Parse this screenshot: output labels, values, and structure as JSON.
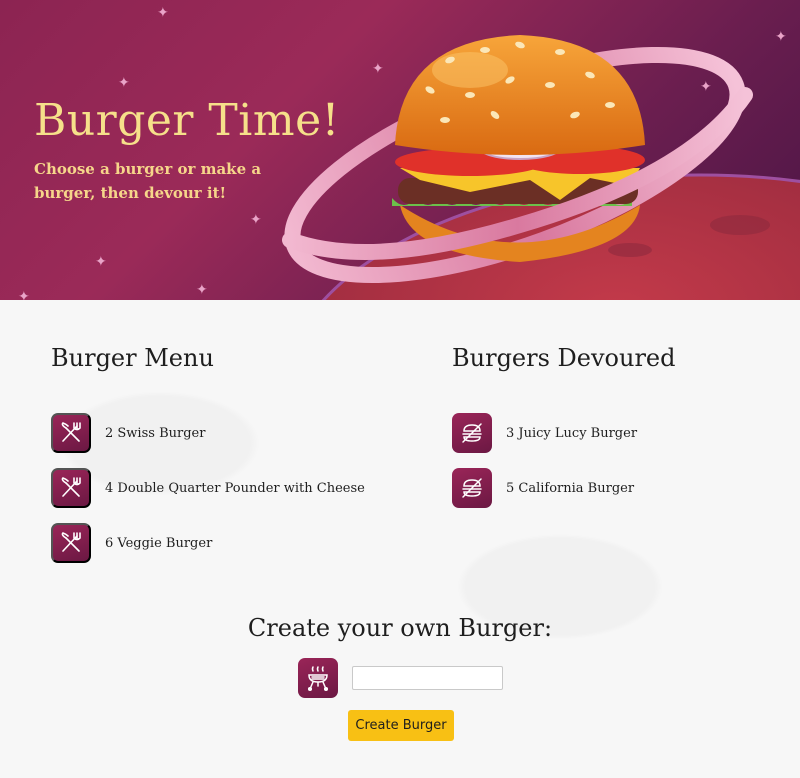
{
  "hero": {
    "title": "Burger Time!",
    "subtitle": "Choose a burger or make a burger, then devour it!"
  },
  "menu": {
    "title": "Burger Menu",
    "items": [
      {
        "label": "2 Swiss Burger",
        "icon": "fork-knife-icon"
      },
      {
        "label": "4 Double Quarter Pounder with Cheese",
        "icon": "fork-knife-icon"
      },
      {
        "label": "6 Veggie Burger",
        "icon": "fork-knife-icon"
      }
    ]
  },
  "devoured": {
    "title": "Burgers Devoured",
    "items": [
      {
        "label": "3 Juicy Lucy Burger",
        "icon": "no-burger-icon"
      },
      {
        "label": "5 California Burger",
        "icon": "no-burger-icon"
      }
    ]
  },
  "create": {
    "title": "Create your own Burger:",
    "input_value": "",
    "input_placeholder": "",
    "button_label": "Create Burger",
    "icon": "grill-icon"
  },
  "colors": {
    "hero_title": "#f6e08a",
    "badge": "#8a2152",
    "button": "#f8c014"
  }
}
